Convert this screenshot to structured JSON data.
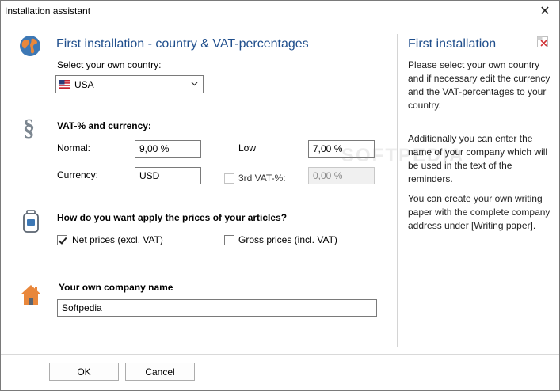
{
  "window": {
    "title": "Installation assistant",
    "close_glyph": "✕"
  },
  "country": {
    "heading": "First installation - country & VAT-percentages",
    "select_label": "Select your own country:",
    "selected": "USA"
  },
  "vat": {
    "section_icon": "§",
    "heading": "VAT-% and currency:",
    "normal_label": "Normal:",
    "normal_value": "9,00 %",
    "low_label": "Low",
    "low_value": "7,00 %",
    "currency_label": "Currency:",
    "currency_value": "USD",
    "third_label": "3rd VAT-%:",
    "third_value": "0,00 %"
  },
  "prices": {
    "heading": "How do you want apply the prices of your articles?",
    "net_label": "Net prices (excl. VAT)",
    "gross_label": "Gross prices (incl. VAT)"
  },
  "company": {
    "heading": "Your own company name",
    "value": "Softpedia"
  },
  "help": {
    "title": "First installation",
    "p1": "Please select your own country and if necessary edit the currency and the VAT-percentages to your country.",
    "p2": "Additionally you can enter the name of your company which will be used in the text of the reminders.",
    "p3": "You can create your own writing paper with the complete company address under [Writing paper]."
  },
  "buttons": {
    "ok": "OK",
    "cancel": "Cancel"
  },
  "colors": {
    "accent": "#1f4e8c",
    "icon_orange": "#e9873b"
  }
}
